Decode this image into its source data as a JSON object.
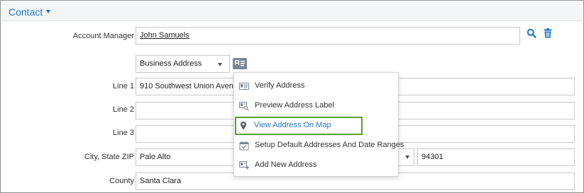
{
  "section": {
    "title": "Contact"
  },
  "account_manager": {
    "label": "Account Manager",
    "value": "John Samuels"
  },
  "address_type": {
    "selected": "Business Address"
  },
  "fields": {
    "line1": {
      "label": "Line 1",
      "value": "910 Southwest Union Avenue"
    },
    "line2": {
      "label": "Line 2",
      "value": ""
    },
    "line3": {
      "label": "Line 3",
      "value": ""
    },
    "city_state_zip": {
      "label": "City, State ZIP",
      "city": "Palo Alto",
      "zip": "94301"
    },
    "county": {
      "label": "County",
      "value": "Santa Clara"
    }
  },
  "address_menu": {
    "items": [
      {
        "label": "Verify Address",
        "icon": "address-card-icon"
      },
      {
        "label": "Preview Address Label",
        "icon": "label-preview-icon"
      },
      {
        "label": "View Address On Map",
        "icon": "map-pin-icon",
        "highlighted": true
      },
      {
        "label": "Setup Default Addresses And Date Ranges",
        "icon": "calendar-check-icon"
      },
      {
        "label": "Add New Address",
        "icon": "add-address-icon"
      }
    ]
  },
  "colors": {
    "accent": "#1e78c8",
    "highlight_border": "#5aa02c",
    "icon_gray": "#7a8694"
  }
}
